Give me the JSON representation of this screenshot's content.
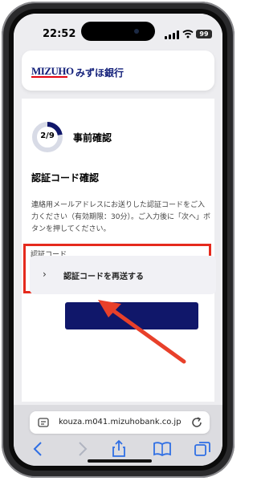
{
  "status_bar": {
    "time": "22:52",
    "battery": "99"
  },
  "header": {
    "logo_en": "MIZUHO",
    "logo_jp": "みずほ銀行"
  },
  "progress": {
    "label": "2/9",
    "fraction": 0.222,
    "step_title": "事前確認"
  },
  "section": {
    "title": "認証コード確認",
    "description": "連絡用メールアドレスにお送りした認証コードをご入力ください（有効期限：30分）。ご入力後に「次へ」ボタンを押してください。"
  },
  "form": {
    "field_label": "認証コード",
    "field_value": ""
  },
  "resend": {
    "label": "認証コードを再送する"
  },
  "browser": {
    "url": "kouza.m041.mizuhobank.co.jp"
  },
  "colors": {
    "brand_navy": "#10176a",
    "highlight_red": "#e52a1d",
    "annotation_arrow": "#e8402a"
  }
}
